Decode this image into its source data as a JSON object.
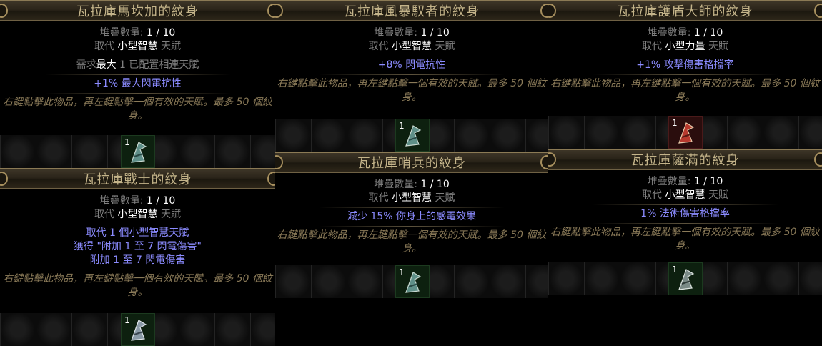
{
  "labels": {
    "stack_label": "堆疊數量: ",
    "stack_value": "1 / 10",
    "replace_prefix": "取代 ",
    "replace_suffix": " 天賦",
    "requires_prefix": "需求",
    "requires_max": "最大",
    "requires_rest": " 1 已配置相連天賦",
    "description": "右鍵點擊此物品，再左鍵點擊一個有效的天賦。最多 50 個紋身。",
    "stack_count": "1"
  },
  "cards": [
    {
      "title": "瓦拉庫馬坎加的紋身",
      "replaces": "小型智慧",
      "mods": [
        "+1% 最大閃電抗性"
      ]
    },
    {
      "title": "瓦拉庫風暴馭者的紋身",
      "replaces": "小型智慧",
      "mods": [
        "+8% 閃電抗性"
      ]
    },
    {
      "title": "瓦拉庫護盾大師的紋身",
      "replaces": "小型力量",
      "mods": [
        "+1% 攻擊傷害格擋率"
      ]
    },
    {
      "title": "瓦拉庫戰士的紋身",
      "replaces": "小型智慧",
      "mods": [
        "取代 1 個小型智慧天賦",
        "獲得 \"附加 1 至 7 閃電傷害\"",
        "附加 1 至 7 閃電傷害"
      ]
    },
    {
      "title": "瓦拉庫哨兵的紋身",
      "replaces": "小型智慧",
      "mods": [
        "減少 15% 你身上的感電效果"
      ]
    },
    {
      "title": "瓦拉庫薩滿的紋身",
      "replaces": "小型智慧",
      "mods": [
        "1% 法術傷害格擋率"
      ]
    }
  ]
}
